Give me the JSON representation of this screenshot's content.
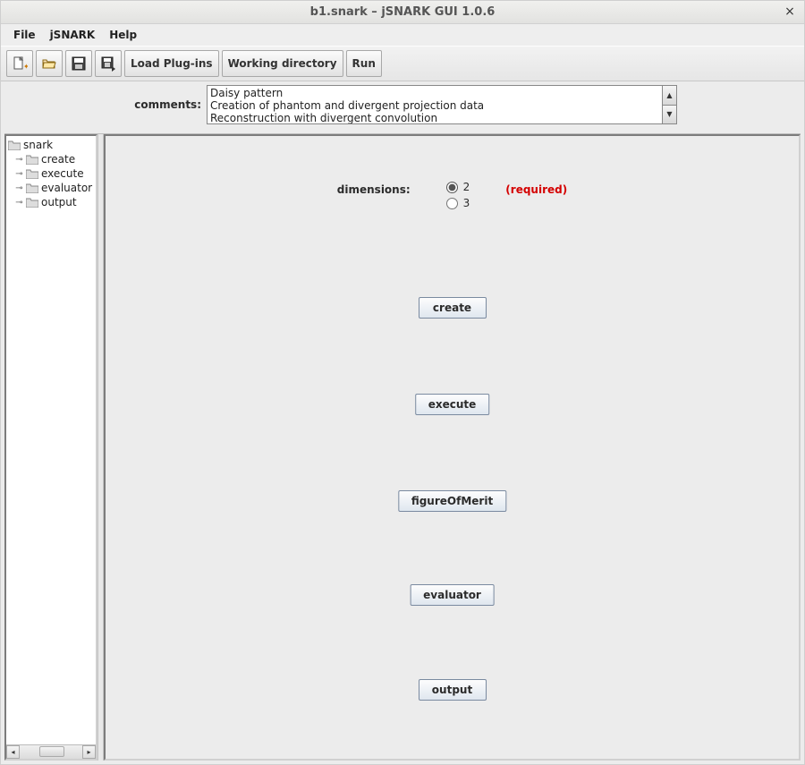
{
  "window": {
    "title": "b1.snark – jSNARK GUI 1.0.6"
  },
  "menubar": {
    "file": "File",
    "jsnark": "jSNARK",
    "help": "Help"
  },
  "toolbar": {
    "load_plugins": "Load Plug-ins",
    "working_dir": "Working directory",
    "run": "Run"
  },
  "comments": {
    "label": "comments:",
    "lines": [
      "Daisy pattern",
      "Creation of phantom and divergent projection data",
      "Reconstruction with divergent convolution"
    ]
  },
  "tree": {
    "root": "snark",
    "children": [
      "create",
      "execute",
      "evaluator",
      "output"
    ]
  },
  "main": {
    "dimensions_label": "dimensions:",
    "dim_options": {
      "two": "2",
      "three": "3"
    },
    "dim_selected": "2",
    "required": "(required)",
    "buttons": {
      "create": "create",
      "execute": "execute",
      "fom": "figureOfMerit",
      "evaluator": "evaluator",
      "output": "output"
    }
  }
}
